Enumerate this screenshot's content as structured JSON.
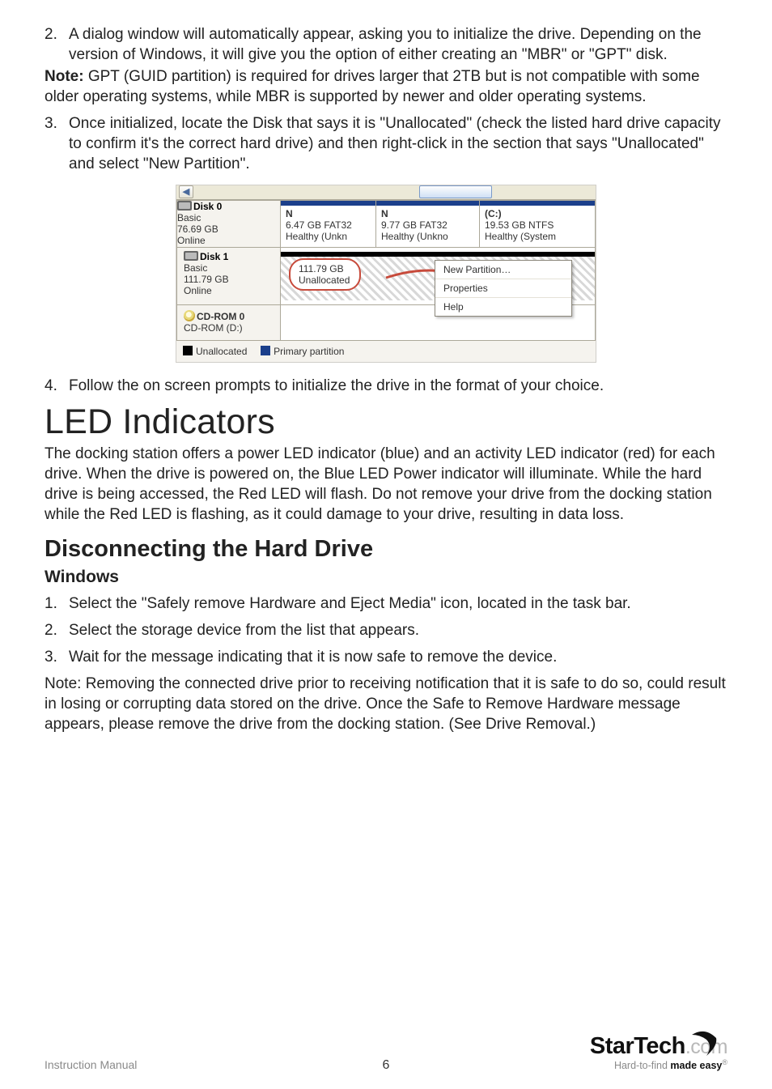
{
  "steps_a": {
    "s2": {
      "num": "2.",
      "text": "A dialog window will automatically appear, asking you to initialize the drive. Depending on the version of Windows, it will give you the option of either creating an \"MBR\" or \"GPT\" disk."
    }
  },
  "note": {
    "label": "Note:",
    "text": " GPT (GUID partition) is required for drives larger that 2TB but is not compatible with some older operating systems, while MBR is supported by newer and older operating systems."
  },
  "steps_b": {
    "s3": {
      "num": "3.",
      "text": "Once initialized, locate the Disk that says it is \"Unallocated\" (check the listed hard drive capacity to confirm it's the correct hard drive) and then right-click in the section that says \"Unallocated\" and select \"New Partition\"."
    }
  },
  "dm": {
    "disk0": {
      "title": "Disk 0",
      "l1": "Basic",
      "l2": "76.69 GB",
      "l3": "Online"
    },
    "vol1": {
      "n": "N",
      "size": "6.47 GB FAT32",
      "status": "Healthy (Unkn"
    },
    "vol2": {
      "n": "N",
      "size": "9.77 GB FAT32",
      "status": "Healthy (Unkno"
    },
    "vol3": {
      "n": "(C:)",
      "size": "19.53 GB NTFS",
      "status": "Healthy (System"
    },
    "disk1": {
      "title": "Disk 1",
      "l1": "Basic",
      "l2": "111.79 GB",
      "l3": "Online"
    },
    "d1vol": {
      "size": "111.79 GB",
      "status": "Unallocated"
    },
    "menu": {
      "i1": "New Partition…",
      "i2": "Properties",
      "i3": "Help"
    },
    "cd": {
      "title": "CD-ROM 0",
      "sub": "CD-ROM (D:)"
    },
    "legend": {
      "un": "Unallocated",
      "pp": "Primary partition"
    }
  },
  "steps_c": {
    "s4": {
      "num": "4.",
      "text": "Follow the on screen prompts to initialize the drive in the format of your choice."
    }
  },
  "led": {
    "h": "LED Indicators",
    "p": "The docking station offers a power LED indicator (blue) and an activity LED indicator (red) for each drive. When the drive is powered on, the Blue LED Power indicator will illuminate. While the hard drive is being accessed, the Red LED will flash. Do not remove your drive from the docking station while the Red LED is flashing, as it could damage to your drive, resulting in data loss."
  },
  "disc": {
    "h": "Disconnecting the Hard Drive",
    "sub": "Windows",
    "s1": {
      "num": "1.",
      "text": "Select the \"Safely remove Hardware and Eject Media\" icon, located in the task bar."
    },
    "s2": {
      "num": "2.",
      "text": "Select the storage device from the list that appears."
    },
    "s3": {
      "num": "3.",
      "text": "Wait for the message indicating that it is now safe to remove the device."
    },
    "note": "Note: Removing the connected drive prior to receiving notification that it is safe to do so, could result in losing or corrupting data stored on the drive. Once the Safe to Remove Hardware message appears, please remove the drive from the docking station. (See Drive Removal.)"
  },
  "footer": {
    "iman": "Instruction Manual",
    "page": "6",
    "brand1": "StarTech",
    "brand2": ".com",
    "tag1": "Hard-to-find ",
    "tag2": "made easy",
    "reg": "®"
  }
}
